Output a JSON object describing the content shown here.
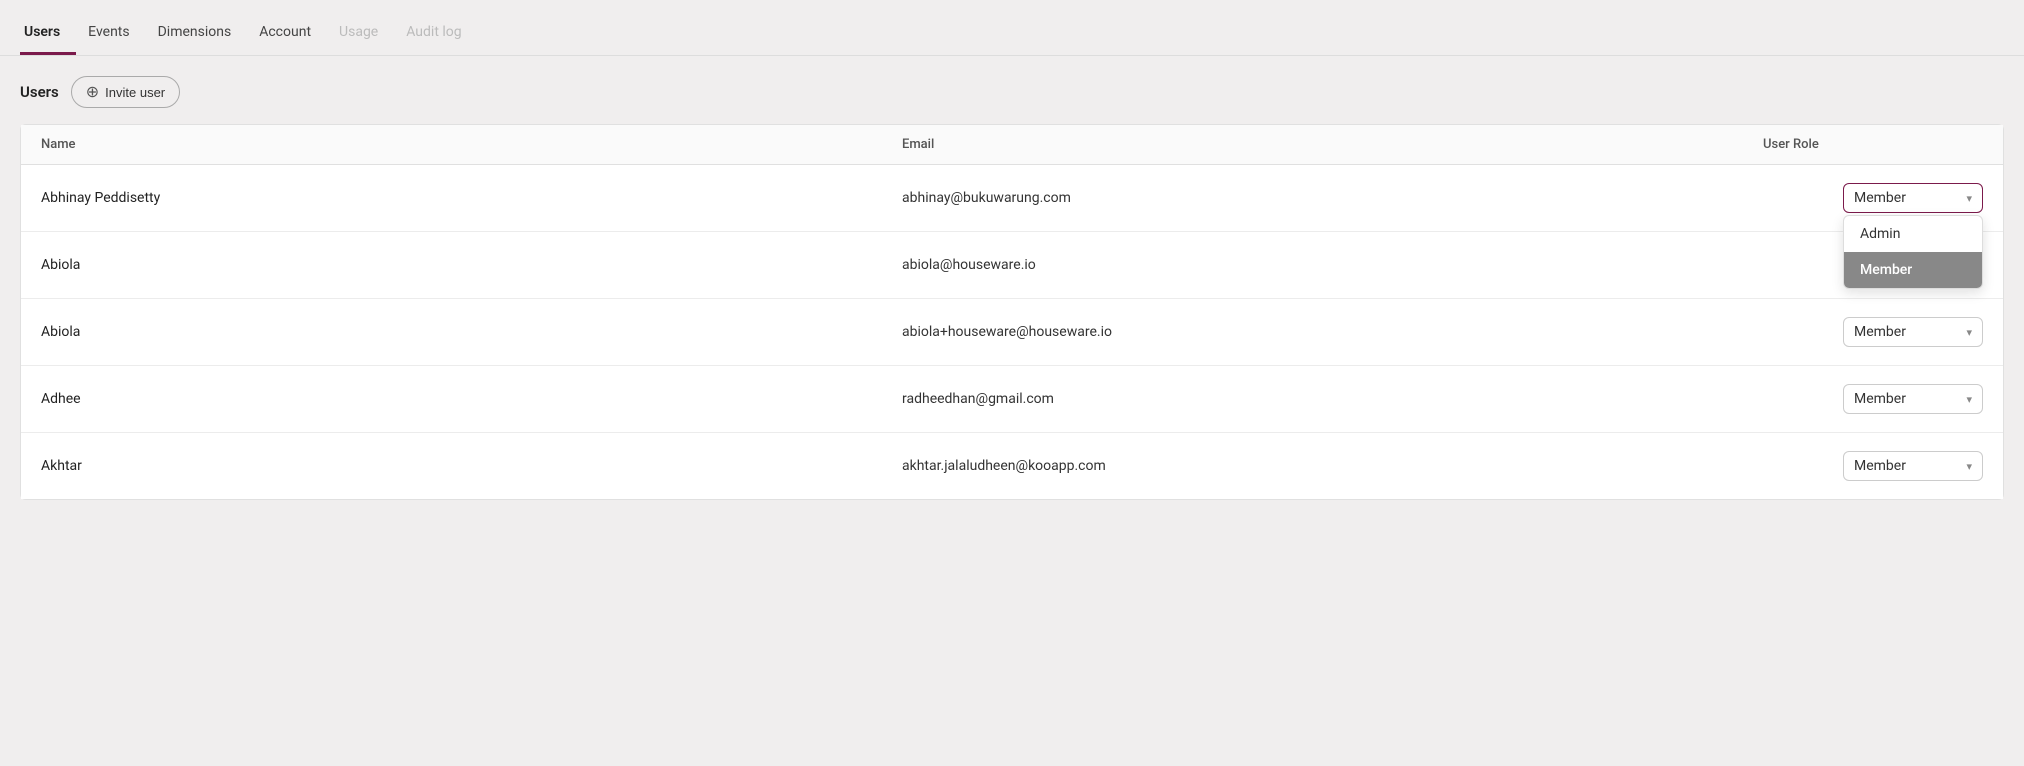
{
  "nav": {
    "tabs": [
      {
        "label": "Users",
        "id": "users",
        "active": true,
        "disabled": false
      },
      {
        "label": "Events",
        "id": "events",
        "active": false,
        "disabled": false
      },
      {
        "label": "Dimensions",
        "id": "dimensions",
        "active": false,
        "disabled": false
      },
      {
        "label": "Account",
        "id": "account",
        "active": false,
        "disabled": false
      },
      {
        "label": "Usage",
        "id": "usage",
        "active": false,
        "disabled": true
      },
      {
        "label": "Audit log",
        "id": "audit-log",
        "active": false,
        "disabled": true
      }
    ]
  },
  "section": {
    "title": "Users",
    "invite_button_label": "Invite user"
  },
  "table": {
    "columns": [
      {
        "label": "Name",
        "id": "name"
      },
      {
        "label": "Email",
        "id": "email"
      },
      {
        "label": "User Role",
        "id": "role"
      }
    ],
    "rows": [
      {
        "name": "Abhinay Peddisetty",
        "email": "abhinay@bukuwarung.com",
        "role": "Member",
        "dropdown_open": true
      },
      {
        "name": "Abiola",
        "email": "abiola@houseware.io",
        "role": "Member",
        "dropdown_open": false
      },
      {
        "name": "Abiola",
        "email": "abiola+houseware@houseware.io",
        "role": "Member",
        "dropdown_open": false
      },
      {
        "name": "Adhee",
        "email": "radheedhan@gmail.com",
        "role": "Member",
        "dropdown_open": false
      },
      {
        "name": "Akhtar",
        "email": "akhtar.jalaludheen@kooapp.com",
        "role": "Member",
        "dropdown_open": false
      }
    ],
    "dropdown_options": [
      {
        "label": "Admin",
        "value": "admin"
      },
      {
        "label": "Member",
        "value": "member",
        "selected": true
      }
    ]
  },
  "colors": {
    "accent": "#7b1a4b",
    "selected_bg": "#888888"
  }
}
